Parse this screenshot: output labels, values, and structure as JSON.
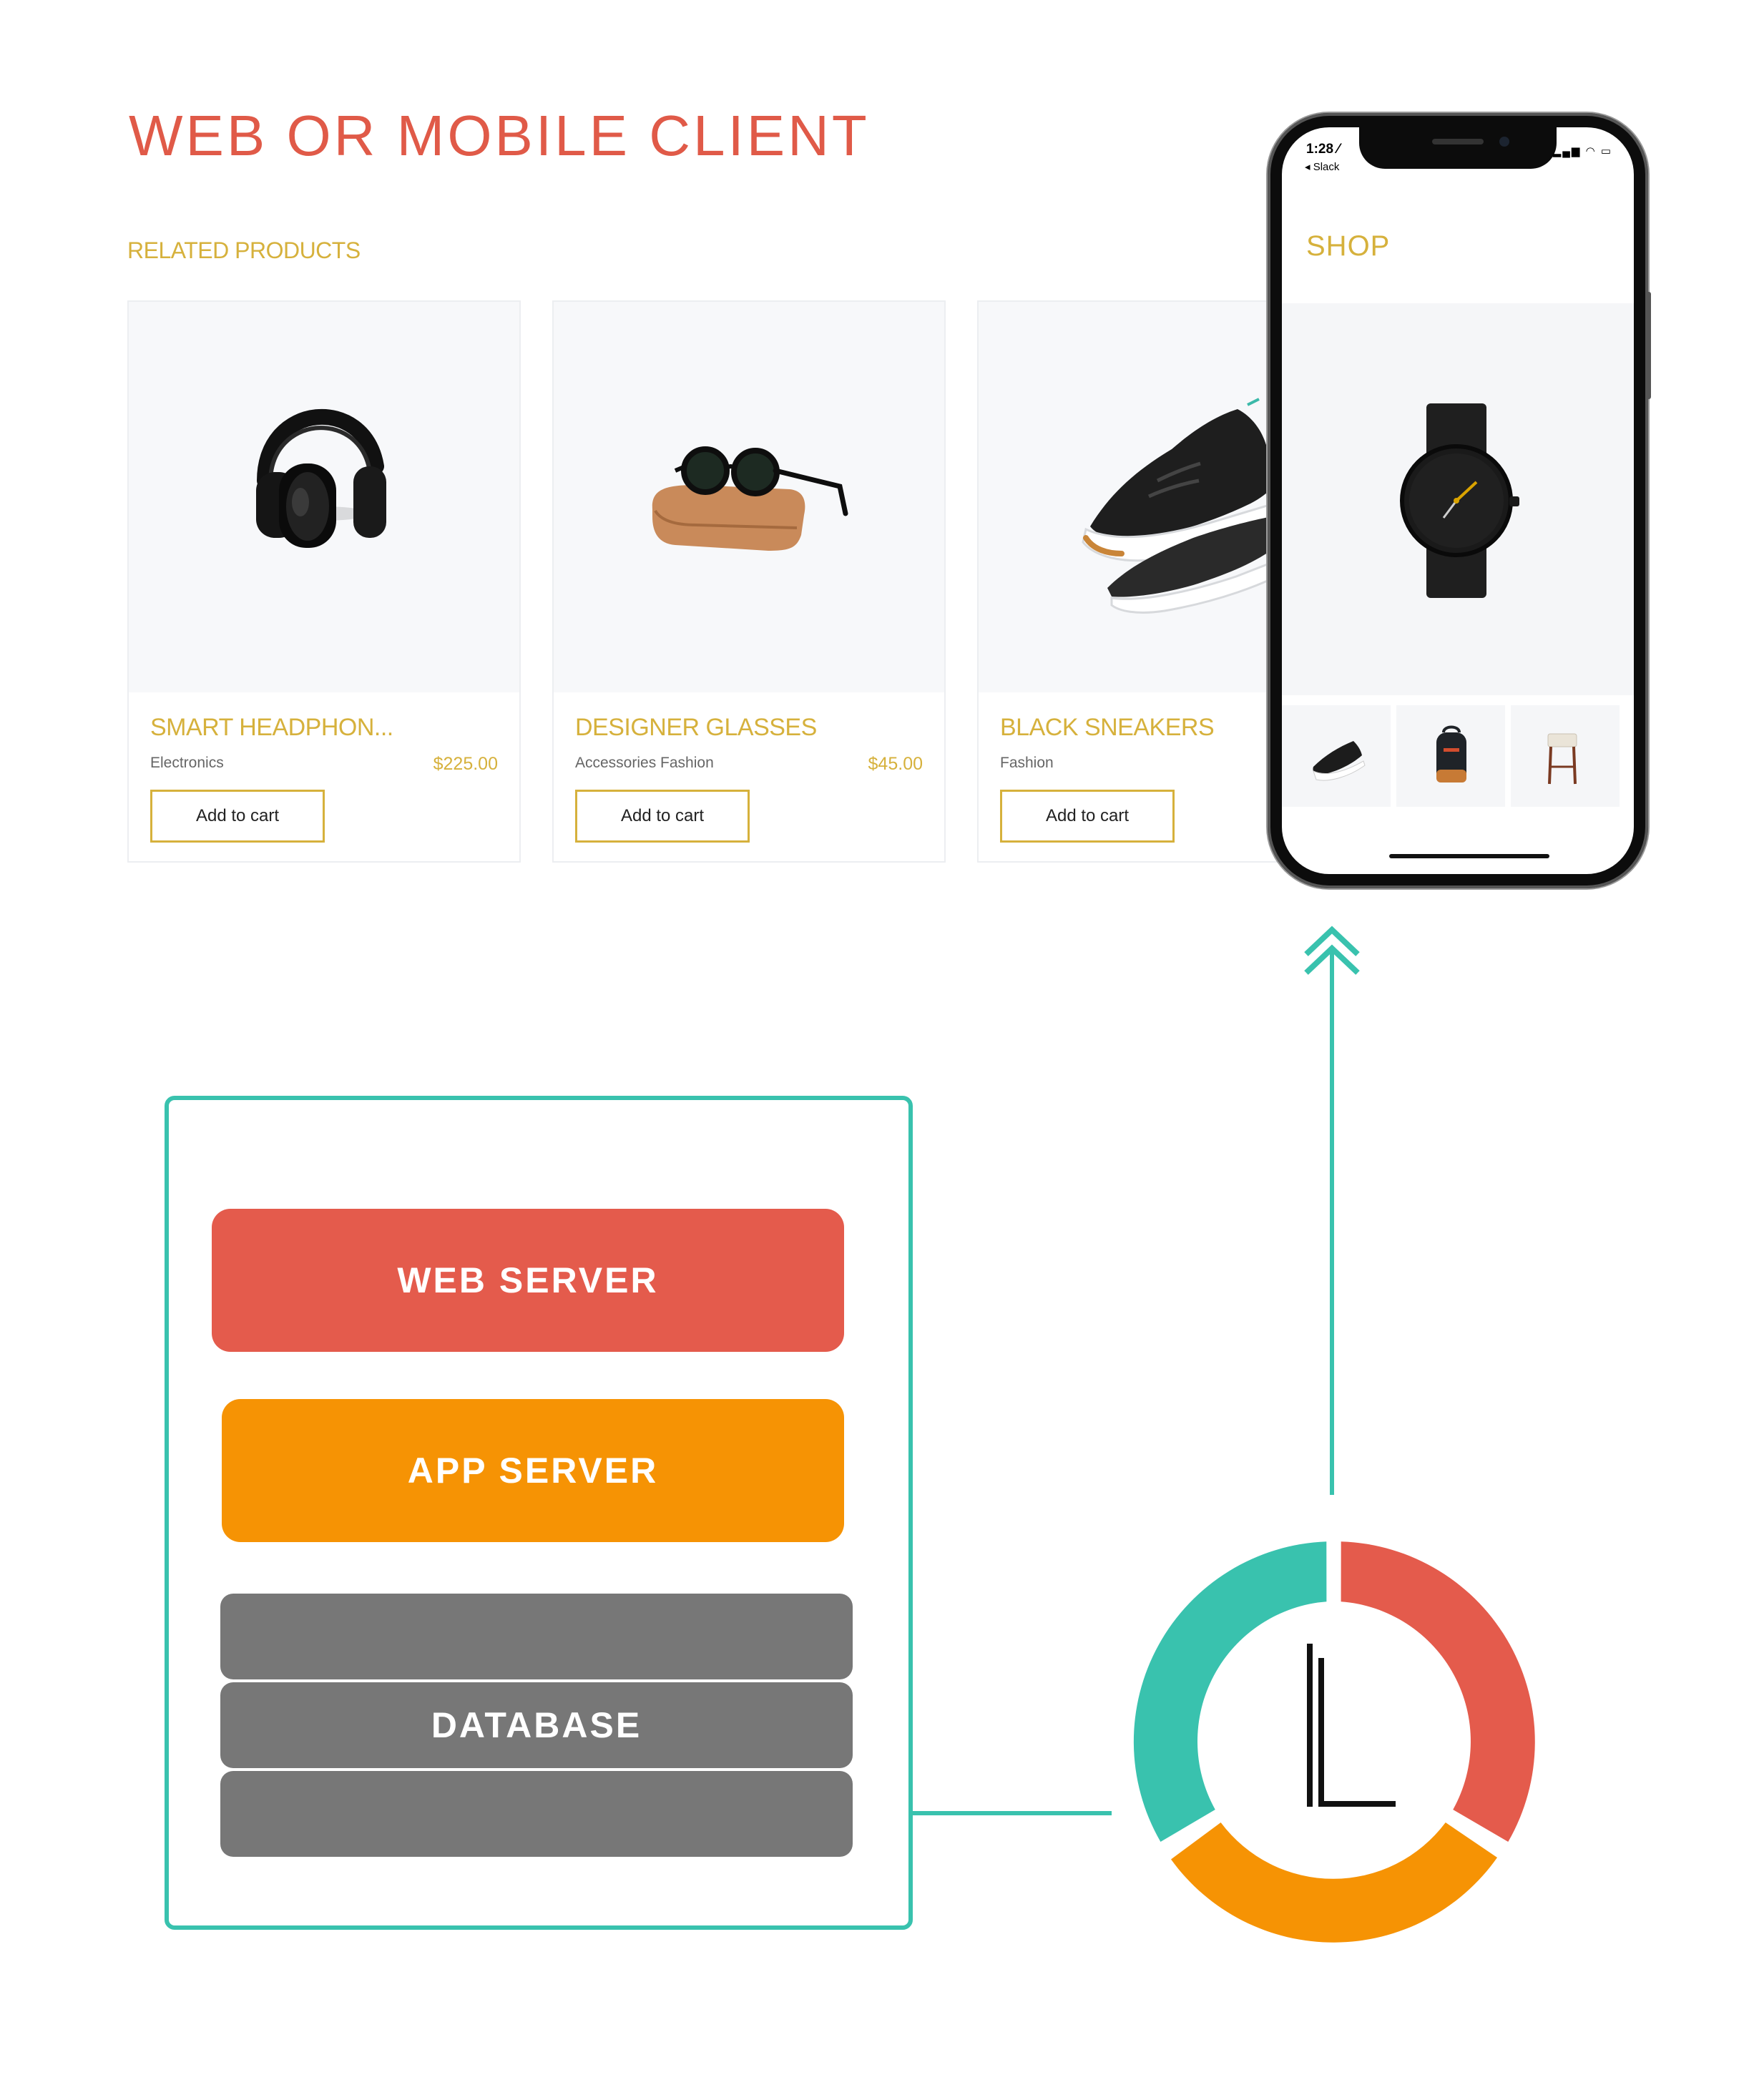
{
  "client": {
    "title": "WEB OR MOBILE CLIENT",
    "related_label": "RELATED PRODUCTS"
  },
  "products": [
    {
      "name": "SMART HEADPHON...",
      "categories": "Electronics",
      "price": "$225.00",
      "button": "Add to cart",
      "icon": "headphones-image"
    },
    {
      "name": "DESIGNER GLASSES",
      "categories": "Accessories   Fashion",
      "price": "$45.00",
      "button": "Add to cart",
      "icon": "sunglasses-image"
    },
    {
      "name": "BLACK SNEAKERS",
      "categories": "Fashion",
      "price": "",
      "button": "Add to cart",
      "icon": "sneaker-image"
    }
  ],
  "phone": {
    "time": "1:28 ⁄",
    "back": "◂ Slack",
    "status_icons": "▂▄▆ ◠ ▭",
    "shop_title": "SHOP",
    "hero_icon": "watch-image",
    "thumbnails": [
      "sneaker-thumb",
      "backpack-thumb",
      "stool-thumb"
    ]
  },
  "stack": {
    "web_server": "WEB SERVER",
    "app_server": "APP SERVER",
    "database": "DATABASE"
  },
  "colors": {
    "accent_red": "#e45b4c",
    "accent_orange": "#f69304",
    "accent_teal": "#39c2ae",
    "gold": "#d6b13c",
    "database_gray": "#777777"
  }
}
